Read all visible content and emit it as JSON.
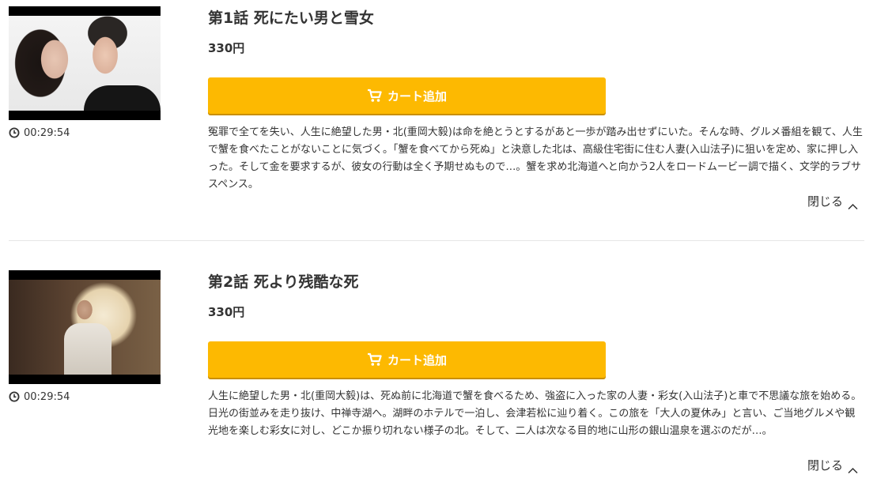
{
  "episodes": [
    {
      "title": "第1話 死にたい男と雪女",
      "price": "330円",
      "duration": "00:29:54",
      "cart_label": "カート追加",
      "description": "冤罪で全てを失い、人生に絶望した男・北(重岡大毅)は命を絶とうとするがあと一歩が踏み出せずにいた。そんな時、グルメ番組を観て、人生で蟹を食べたことがないことに気づく。「蟹を食べてから死ぬ」と決意した北は、高級住宅街に住む人妻(入山法子)に狙いを定め、家に押し入った。そして金を要求するが、彼女の行動は全く予期せぬもので…。蟹を求め北海道へと向かう2人をロードムービー調で描く、文学的ラブサスペンス。",
      "close_label": "閉じる",
      "icons": {
        "clock": "clock-icon",
        "cart": "cart-icon",
        "chevron": "chevron-up-icon"
      }
    },
    {
      "title": "第2話 死より残酷な死",
      "price": "330円",
      "duration": "00:29:54",
      "cart_label": "カート追加",
      "description": "人生に絶望した男・北(重岡大毅)は、死ぬ前に北海道で蟹を食べるため、強盗に入った家の人妻・彩女(入山法子)と車で不思議な旅を始める。日光の街並みを走り抜け、中禅寺湖へ。湖畔のホテルで一泊し、会津若松に辿り着く。この旅を「大人の夏休み」と言い、ご当地グルメや観光地を楽しむ彩女に対し、どこか振り切れない様子の北。そして、二人は次なる目的地に山形の銀山温泉を選ぶのだが…。",
      "close_label": "閉じる",
      "icons": {
        "clock": "clock-icon",
        "cart": "cart-icon",
        "chevron": "chevron-up-icon"
      }
    }
  ],
  "colors": {
    "accent": "#fdb901",
    "text": "#333333",
    "divider": "#e6e6e6"
  }
}
